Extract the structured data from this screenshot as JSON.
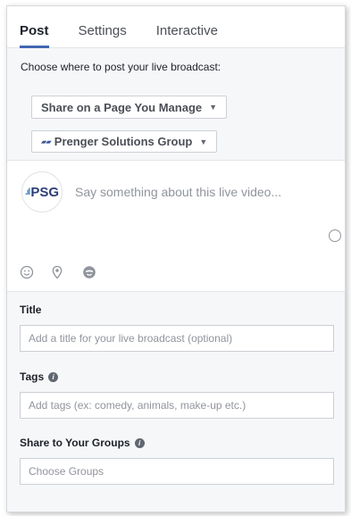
{
  "tabs": [
    {
      "label": "Post",
      "active": true
    },
    {
      "label": "Settings",
      "active": false
    },
    {
      "label": "Interactive",
      "active": false
    }
  ],
  "post": {
    "choose_label": "Choose where to post your live broadcast:",
    "destination_select": "Share on a Page You Manage",
    "page_select": "Prenger Solutions Group",
    "avatar_text": "PSG",
    "composer_placeholder": "Say something about this live video..."
  },
  "toolbar_icons": [
    "emoji-icon",
    "location-pin-icon",
    "feeling-icon"
  ],
  "title_section": {
    "label": "Title",
    "placeholder": "Add a title for your live broadcast (optional)"
  },
  "tags_section": {
    "label": "Tags",
    "placeholder": "Add tags (ex: comedy, animals, make-up etc.)"
  },
  "groups_section": {
    "label": "Share to Your Groups",
    "placeholder": "Choose Groups"
  },
  "colors": {
    "accent": "#4267b2",
    "border": "#ccd0d5",
    "placeholder": "#90949c",
    "background": "#f6f7f9"
  }
}
